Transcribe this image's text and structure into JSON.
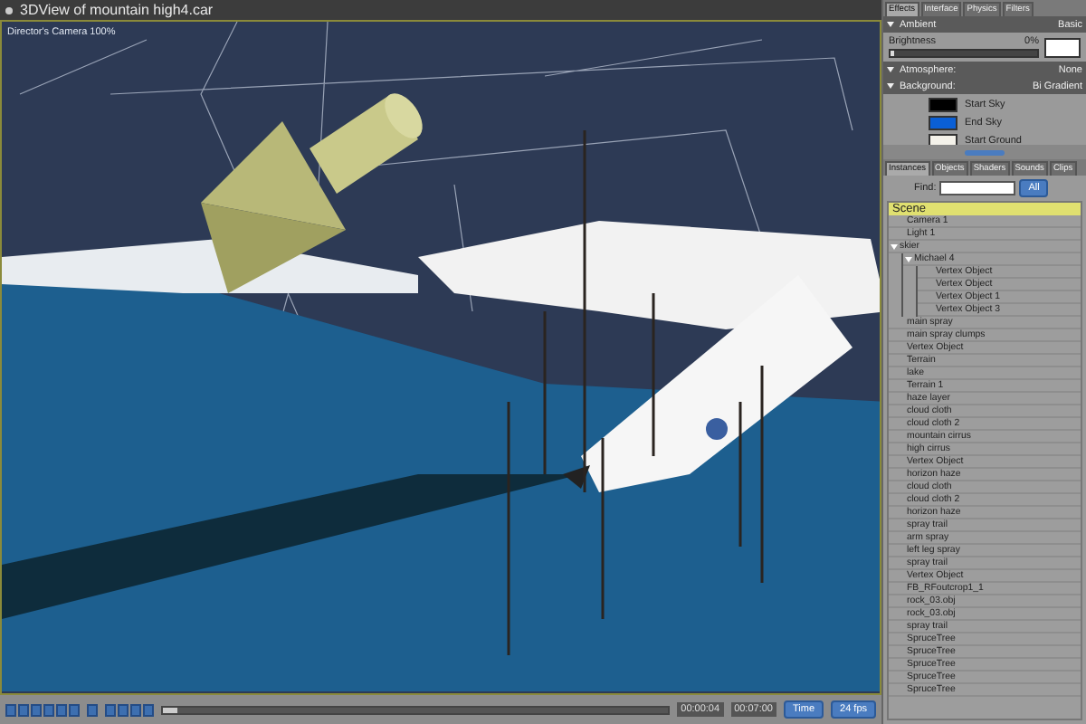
{
  "window": {
    "title": "3DView of mountain high4.car"
  },
  "viewport": {
    "camera_label": "Director's Camera 100%"
  },
  "effects_panel": {
    "tabs": [
      {
        "label": "Effects",
        "selected": true
      },
      {
        "label": "Interface",
        "selected": false
      },
      {
        "label": "Physics",
        "selected": false
      },
      {
        "label": "Filters",
        "selected": false
      }
    ],
    "ambient": {
      "label": "Ambient",
      "mode": "Basic",
      "brightness": {
        "label": "Brightness",
        "reading": "0%",
        "level": 0.02
      },
      "color": "#ffffff"
    },
    "atmosphere": {
      "label": "Atmosphere:",
      "value": "None"
    },
    "background": {
      "label": "Background:",
      "mode": "Bi Gradient",
      "swatches": [
        {
          "label": "Start Sky",
          "color": "#000000"
        },
        {
          "label": "End Sky",
          "color": "#0a5fd6"
        },
        {
          "label": "Start Ground",
          "color": "#f4f2ea"
        }
      ]
    }
  },
  "instances_panel": {
    "tabs": [
      {
        "label": "Instances",
        "selected": true
      },
      {
        "label": "Objects",
        "selected": false
      },
      {
        "label": "Shaders",
        "selected": false
      },
      {
        "label": "Sounds",
        "selected": false
      },
      {
        "label": "Clips",
        "selected": false
      }
    ],
    "find_label": "Find:",
    "filter": "All",
    "header": "Scene",
    "items": [
      {
        "label": "Camera 1"
      },
      {
        "label": "Light 1"
      },
      {
        "label": "skier",
        "expanded": true,
        "children": [
          {
            "label": "Michael 4",
            "expanded": true,
            "children": [
              {
                "label": "Vertex Object"
              },
              {
                "label": "Vertex Object"
              },
              {
                "label": "Vertex Object 1"
              },
              {
                "label": "Vertex Object 3"
              }
            ]
          }
        ]
      },
      {
        "label": "main spray"
      },
      {
        "label": "main spray clumps"
      },
      {
        "label": "Vertex Object"
      },
      {
        "label": "Terrain"
      },
      {
        "label": "lake"
      },
      {
        "label": "Terrain 1"
      },
      {
        "label": "haze layer"
      },
      {
        "label": "cloud cloth"
      },
      {
        "label": "cloud cloth 2"
      },
      {
        "label": "mountain cirrus"
      },
      {
        "label": "high cirrus"
      },
      {
        "label": "Vertex Object"
      },
      {
        "label": "horizon haze"
      },
      {
        "label": "cloud cloth"
      },
      {
        "label": "cloud cloth 2"
      },
      {
        "label": "horizon haze"
      },
      {
        "label": "spray trail"
      },
      {
        "label": "arm spray"
      },
      {
        "label": "left leg spray"
      },
      {
        "label": "spray trail"
      },
      {
        "label": "Vertex Object"
      },
      {
        "label": "FB_RFoutcrop1_1"
      },
      {
        "label": "rock_03.obj"
      },
      {
        "label": "rock_03.obj"
      },
      {
        "label": "spray trail"
      },
      {
        "label": "SpruceTree"
      },
      {
        "label": "SpruceTree"
      },
      {
        "label": "SpruceTree"
      },
      {
        "label": "SpruceTree"
      },
      {
        "label": "SpruceTree"
      }
    ]
  },
  "timeline": {
    "position": {
      "level": 0.03
    },
    "current_time": "00:00:04",
    "total_time": "00:07:00",
    "time_mode": "Time",
    "frame_rate": "24 fps"
  }
}
